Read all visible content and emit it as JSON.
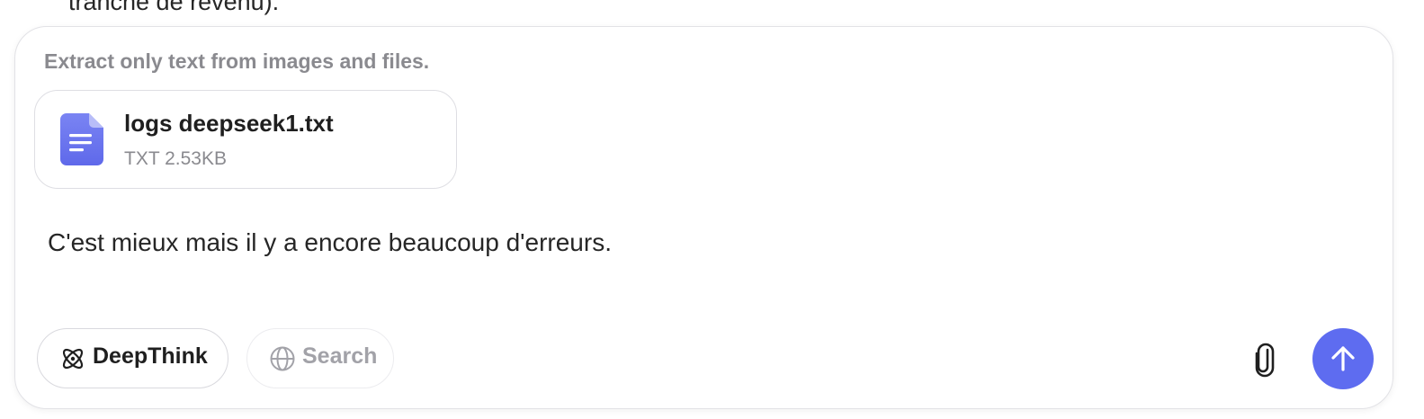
{
  "previous_message": {
    "text_fragment": "tranche de revenu)."
  },
  "composer": {
    "hint": "Extract only text from images and files.",
    "attachment": {
      "name": "logs deepseek1.txt",
      "meta": "TXT 2.53KB",
      "icon": "document-icon"
    },
    "message": "C'est mieux mais il y a encore beaucoup d'erreurs.",
    "toolbar": {
      "deepthink_label": "DeepThink",
      "deepthink_icon": "atom-icon",
      "search_label": "Search",
      "search_icon": "globe-icon",
      "attach_icon": "paperclip-icon",
      "send_icon": "arrow-up-icon"
    }
  },
  "colors": {
    "accent": "#5e6cf0",
    "file_icon": "#6e78ef",
    "text_muted": "#8a8a8f"
  }
}
